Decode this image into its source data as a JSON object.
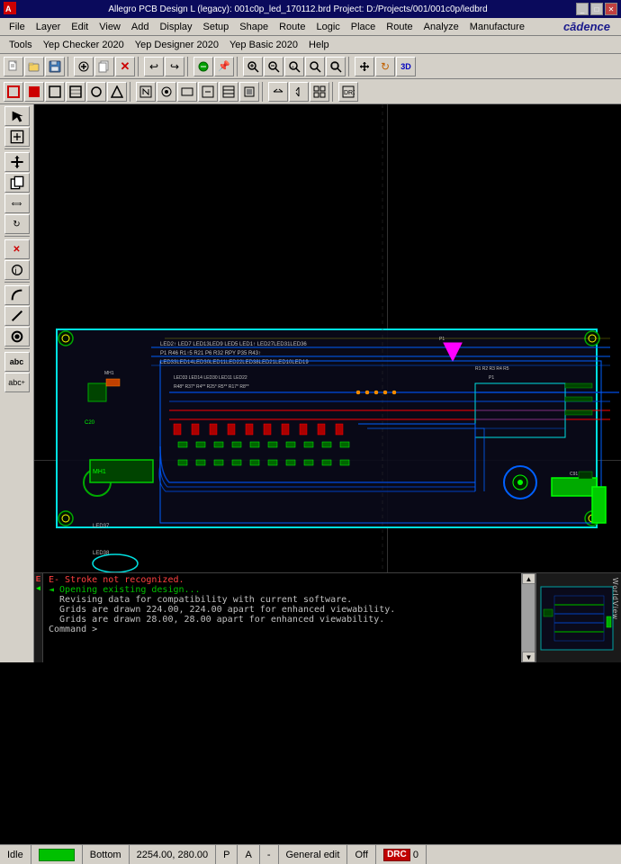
{
  "title": {
    "text": "Allegro PCB Design L (legacy): 001c0p_led_170112.brd  Project: D:/Projects/001/001c0p/ledbrd",
    "logo": "cādence"
  },
  "menu1": {
    "items": [
      "File",
      "Layer",
      "Edit",
      "View",
      "Add",
      "Display",
      "Setup",
      "Shape",
      "Route",
      "Logic",
      "Place",
      "Route",
      "Analyze",
      "Manufacture"
    ]
  },
  "menu2": {
    "items": [
      "Tools",
      "Yep Checker 2020",
      "Yep Designer 2020",
      "Yep Basic 2020",
      "Help"
    ]
  },
  "console": {
    "lines": [
      "E- Stroke not recognized.",
      "< Opening existing design...",
      "  Revising data for compatibility with current software.",
      "  Grids are drawn 224.00, 224.00 apart for enhanced viewability.",
      "  Grids are drawn 28.00, 28.00 apart for enhanced viewability.",
      "Command >"
    ]
  },
  "status": {
    "mode": "Idle",
    "layer": "Bottom",
    "coords": "2254.00, 280.00",
    "p_label": "P",
    "a_label": "A",
    "separator": "-",
    "edit_mode": "General edit",
    "off_label": "Off",
    "drc_label": "DRC",
    "drc_count": "0"
  },
  "minimap_label": "WorldView",
  "toolbar1": {
    "buttons": [
      "📂",
      "💾",
      "✂",
      "📋",
      "↩",
      "↪",
      "🔍",
      "📌",
      "⊞",
      "⊟",
      "⊕",
      "⊗",
      "🔄",
      "3D"
    ]
  },
  "toolbar2": {
    "buttons": [
      "▣",
      "■",
      "□",
      "▦",
      "◯",
      "↗",
      "⬜",
      "◉",
      "▭",
      "⊡",
      "▤",
      "⊞",
      "←→",
      "↕",
      "⊞"
    ]
  }
}
